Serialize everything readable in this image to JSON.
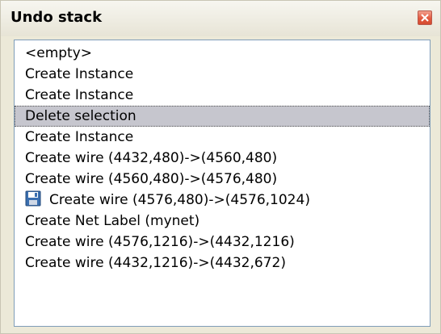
{
  "window": {
    "title": "Undo stack",
    "close_icon": "close-icon",
    "accent_color": "#e35a3f"
  },
  "list": {
    "selected_index": 3,
    "items": [
      {
        "label": "<empty>"
      },
      {
        "label": "Create Instance"
      },
      {
        "label": "Create Instance"
      },
      {
        "label": "Delete selection"
      },
      {
        "label": "Create Instance"
      },
      {
        "label": "Create wire (4432,480)->(4560,480)"
      },
      {
        "label": "Create wire (4560,480)->(4576,480)"
      },
      {
        "label": "Create wire (4576,480)->(4576,1024)",
        "icon": "save-floppy-icon"
      },
      {
        "label": "Create Net Label (mynet)"
      },
      {
        "label": "Create wire (4576,1216)->(4432,1216)"
      },
      {
        "label": "Create wire (4432,1216)->(4432,672)"
      }
    ]
  }
}
